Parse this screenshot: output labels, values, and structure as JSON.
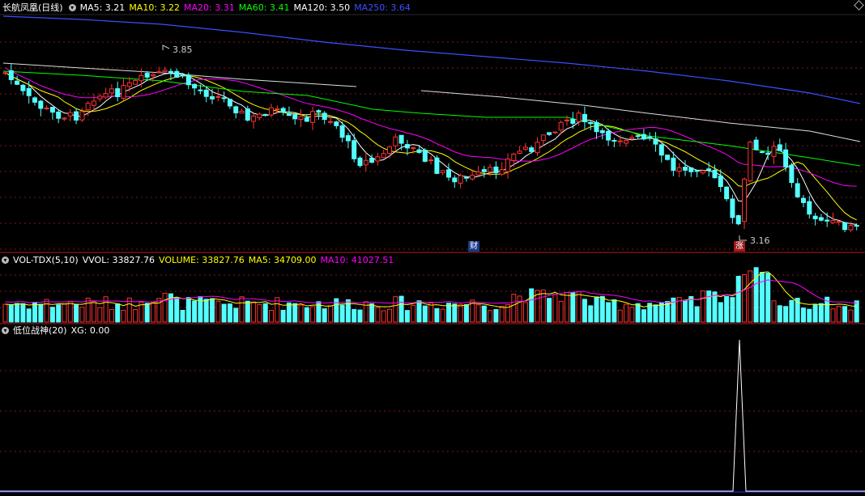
{
  "main_panel": {
    "title": "长航凤凰(日线)",
    "indicators": [
      {
        "label": "MA5: 3.21",
        "color": "#ffffff"
      },
      {
        "label": "MA10: 3.22",
        "color": "#ffff00"
      },
      {
        "label": "MA20: 3.31",
        "color": "#ff00ff"
      },
      {
        "label": "MA60: 3.41",
        "color": "#00ff00"
      },
      {
        "label": "MA120: 3.50",
        "color": "#ffffff"
      },
      {
        "label": "MA250: 3.64",
        "color": "#3a50ff"
      }
    ],
    "high_label": "3.85",
    "low_label": "3.16",
    "badge_cai": "财",
    "badge_zhang": "涨"
  },
  "volume_panel": {
    "title": "VOL-TDX(5,10)",
    "indicators": [
      {
        "label": "VVOL: 33827.76",
        "color": "#ffffff"
      },
      {
        "label": "VOLUME: 33827.76",
        "color": "#ffff00"
      },
      {
        "label": "MA5: 34709.00",
        "color": "#ffff00"
      },
      {
        "label": "MA10: 41027.51",
        "color": "#ff00ff"
      }
    ]
  },
  "signal_panel": {
    "title": "低位战神(20)",
    "indicators": [
      {
        "label": "XG: 0.00",
        "color": "#ffffff"
      }
    ]
  },
  "colors": {
    "up": "#ff3232",
    "down": "#54ffff",
    "grid": "#7a1b1b",
    "divider": "#b01c1c"
  }
}
